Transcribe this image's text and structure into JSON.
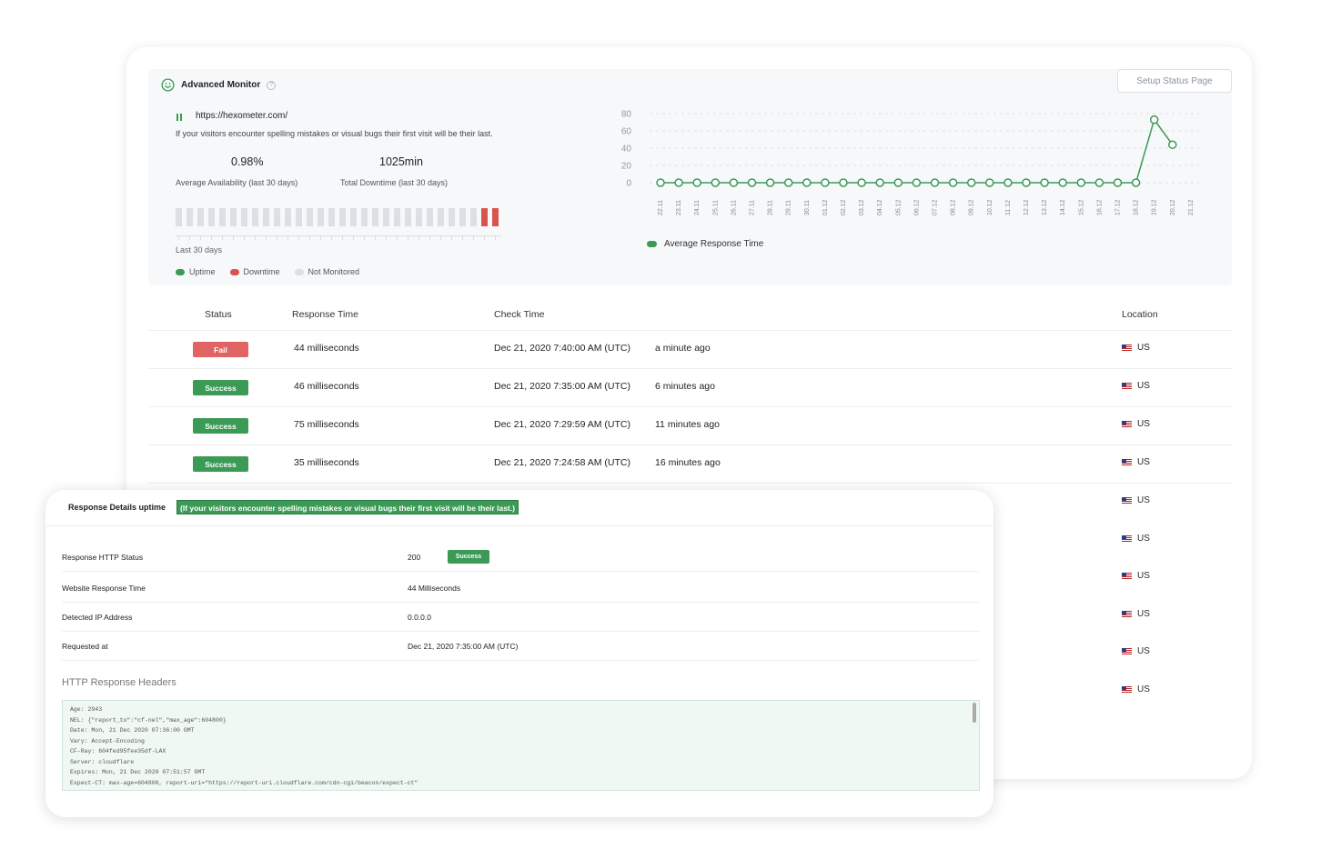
{
  "summary": {
    "title": "Advanced Monitor",
    "help": "?",
    "setup_button": "Setup Status Page",
    "url": "https://hexometer.com/",
    "description": "If your visitors encounter spelling mistakes or visual bugs their first visit will be their last.",
    "availability_value": "0.98%",
    "availability_label": "Average Availability (last 30 days)",
    "downtime_value": "1025min",
    "downtime_label": "Total Downtime (last 30 days)",
    "bars_label": "Last 30 days",
    "legend": {
      "uptime": "Uptime",
      "downtime": "Downtime",
      "not_monitored": "Not Monitored"
    },
    "colors": {
      "uptime": "#3a9a56",
      "downtime": "#d9534f",
      "not_monitored": "#dcdfe4"
    }
  },
  "chart_data": {
    "type": "line",
    "x": [
      "22.11",
      "23.11",
      "24.11",
      "25.11",
      "26.11",
      "27.11",
      "28.11",
      "29.11",
      "30.11",
      "01.12",
      "02.12",
      "03.12",
      "04.12",
      "05.12",
      "06.12",
      "07.12",
      "08.12",
      "09.12",
      "10.12",
      "11.12",
      "12.12",
      "13.12",
      "14.12",
      "15.12",
      "16.12",
      "17.12",
      "18.12",
      "19.12",
      "20.12",
      "21.12"
    ],
    "series": [
      {
        "name": "Average Response Time",
        "values": [
          0,
          0,
          0,
          0,
          0,
          0,
          0,
          0,
          0,
          0,
          0,
          0,
          0,
          0,
          0,
          0,
          0,
          0,
          0,
          0,
          0,
          0,
          0,
          0,
          0,
          0,
          0,
          73,
          44,
          null
        ]
      }
    ],
    "yticks": [
      "80",
      "60",
      "40",
      "20",
      "0"
    ],
    "ylim": [
      0,
      80
    ],
    "grid": true,
    "legend_position": "bottom-left",
    "color": "#3a9a56"
  },
  "table": {
    "headers": {
      "status": "Status",
      "response_time": "Response Time",
      "check_time": "Check Time",
      "location": "Location"
    },
    "rows": [
      {
        "status": "Fail",
        "response": "44 milliseconds",
        "time": "Dec 21, 2020 7:40:00 AM (UTC)",
        "ago": "a minute ago",
        "location": "US"
      },
      {
        "status": "Success",
        "response": "46 milliseconds",
        "time": "Dec 21, 2020 7:35:00 AM (UTC)",
        "ago": "6 minutes ago",
        "location": "US"
      },
      {
        "status": "Success",
        "response": "75 milliseconds",
        "time": "Dec 21, 2020 7:29:59 AM (UTC)",
        "ago": "11 minutes ago",
        "location": "US"
      },
      {
        "status": "Success",
        "response": "35 milliseconds",
        "time": "Dec 21, 2020 7:24:58 AM (UTC)",
        "ago": "16 minutes ago",
        "location": "US"
      }
    ],
    "extra_locations": [
      "US",
      "US",
      "US",
      "US",
      "US",
      "US"
    ]
  },
  "details": {
    "title": "Response Details uptime",
    "highlight": "(If your visitors encounter spelling mistakes or visual bugs their first visit will be their last.)",
    "rows": [
      {
        "label": "Response HTTP Status",
        "value": "200",
        "badge": "Success"
      },
      {
        "label": "Website Response Time",
        "value": "44 Milliseconds"
      },
      {
        "label": "Detected IP Address",
        "value": "0.0.0.0"
      },
      {
        "label": "Requested at",
        "value": "Dec 21, 2020 7:35:00 AM (UTC)"
      }
    ],
    "headers_title": "HTTP Response Headers",
    "headers_lines": [
      "Age: 2943",
      "NEL: {\"report_to\":\"cf-nel\",\"max_age\":604800}",
      "Date: Mon, 21 Dec 2020 07:36:00 GMT",
      "Vary: Accept-Encoding",
      "CF-Ray: 604fed95fee35df-LAX",
      "Server: cloudflare",
      "Expires: Mon, 21 Dec 2020 07:51:57 GMT",
      "Expect-CT: max-age=604800, report-uri=\"https://report-uri.cloudflare.com/cdn-cgi/beacon/expect-ct\""
    ]
  }
}
